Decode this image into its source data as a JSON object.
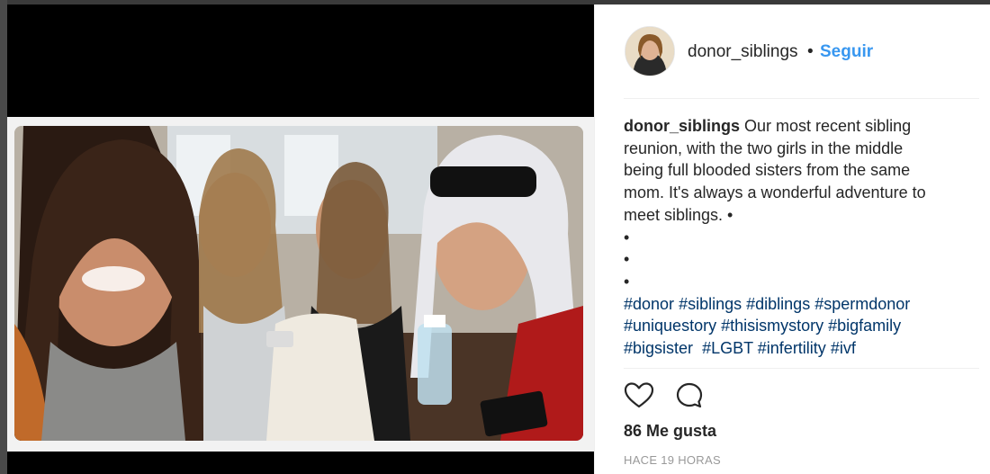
{
  "post": {
    "username": "donor_siblings",
    "separator": "•",
    "follow_label": "Seguir",
    "avatar_icon": "profile-avatar",
    "photo_icon": "group-selfie-photo",
    "caption": {
      "username": "donor_siblings",
      "lines": [
        "Our most recent sibling",
        "reunion, with the two girls in the middle",
        "being full blooded sisters from the same",
        "mom. It's always a wonderful adventure to",
        "meet siblings. •",
        "•",
        "•",
        "•"
      ],
      "hashtags": [
        [
          "#donor",
          "#siblings",
          "#diblings",
          "#spermdonor"
        ],
        [
          "#uniquestory",
          "#thisismystory",
          "#bigfamily"
        ],
        [
          "#bigsister",
          "#LGBT",
          "#infertility",
          "#ivf"
        ]
      ]
    },
    "actions": {
      "like_icon": "heart-icon",
      "comment_icon": "comment-icon"
    },
    "likes": "86 Me gusta",
    "timestamp": "HACE 19 HORAS"
  },
  "colors": {
    "accent": "#3897f0",
    "hashtag": "#003569",
    "text": "#262626",
    "muted": "#999999"
  }
}
